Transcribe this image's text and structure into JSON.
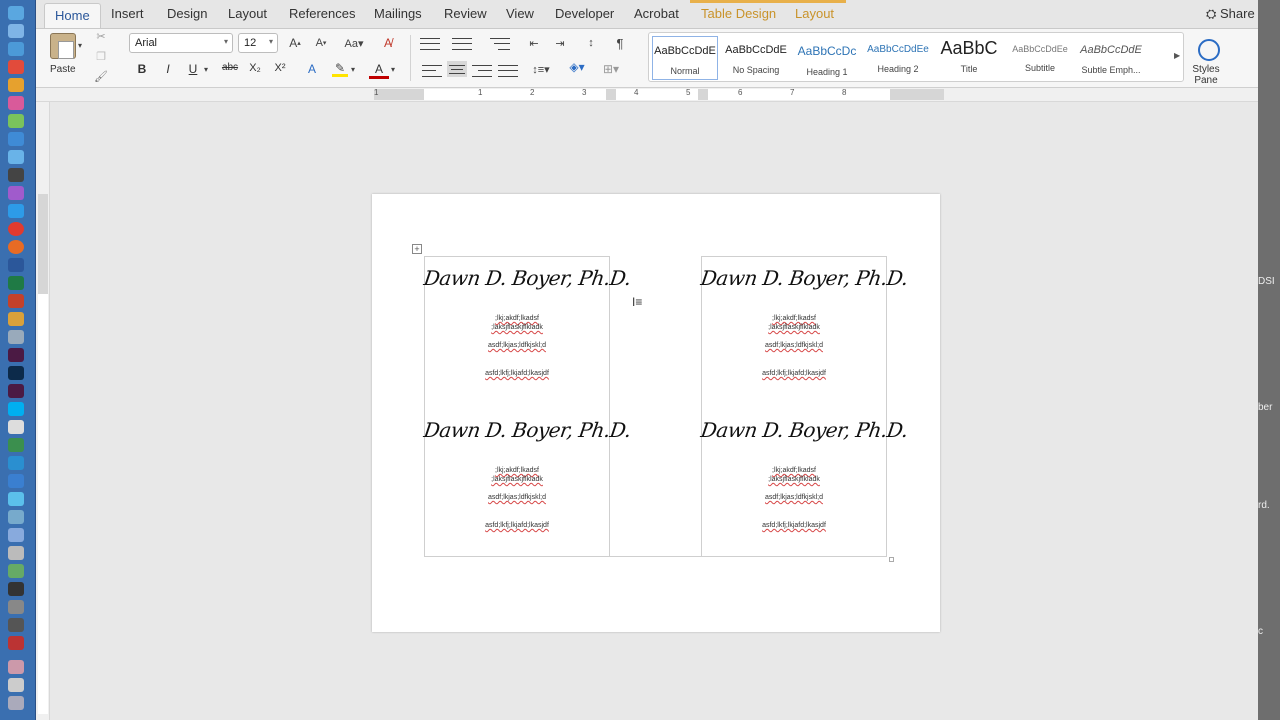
{
  "tabs": [
    {
      "label": "Home"
    },
    {
      "label": "Insert"
    },
    {
      "label": "Design"
    },
    {
      "label": "Layout"
    },
    {
      "label": "References"
    },
    {
      "label": "Mailings"
    },
    {
      "label": "Review"
    },
    {
      "label": "View"
    },
    {
      "label": "Developer"
    },
    {
      "label": "Acrobat"
    }
  ],
  "context_tabs": [
    {
      "label": "Table Design"
    },
    {
      "label": "Layout"
    }
  ],
  "share_label": "Share",
  "clipboard": {
    "paste_label": "Paste"
  },
  "font": {
    "name": "Arial",
    "size": "12"
  },
  "format_buttons": {
    "bold": "B",
    "italic": "I",
    "underline": "U",
    "strike": "abc",
    "sub": "X₂",
    "sup": "X²",
    "font_color": "A",
    "text_effects": "A"
  },
  "paragraph": {
    "show_marks": "¶"
  },
  "styles": [
    {
      "sample": "AaBbCcDdE",
      "name": "Normal"
    },
    {
      "sample": "AaBbCcDdE",
      "name": "No Spacing"
    },
    {
      "sample": "AaBbCcDc",
      "name": "Heading 1"
    },
    {
      "sample": "AaBbCcDdEe",
      "name": "Heading 2"
    },
    {
      "sample": "AaBbC",
      "name": "Title"
    },
    {
      "sample": "AaBbCcDdEe",
      "name": "Subtitle"
    },
    {
      "sample": "AaBbCcDdE",
      "name": "Subtle Emph..."
    }
  ],
  "styles_pane": {
    "line1": "Styles",
    "line2": "Pane"
  },
  "ruler": {
    "numbers": [
      "1",
      "1",
      "2",
      "3",
      "4",
      "5",
      "6",
      "7",
      "8"
    ]
  },
  "labels": [
    {
      "signature": "Dawn D. Boyer, Ph.D.",
      "line1": ";lkj;akdf;lkadsf",
      "line2": ";laksjflaskjflkladk",
      "line3": "asdf;lkjas;ldfkjskl;d",
      "line4": "asfd;lkfj;lkjafd;lkasjdf"
    },
    {
      "signature": "Dawn D. Boyer, Ph.D.",
      "line1": ";lkj;akdf;lkadsf",
      "line2": ";laksjflaskjflkladk",
      "line3": "asdf;lkjas;ldfkjskl;d",
      "line4": "asfd;lkfj;lkjafd;lkasjdf"
    },
    {
      "signature": "Dawn D. Boyer, Ph.D.",
      "line1": ";lkj;akdf;lkadsf",
      "line2": ";laksjflaskjflkladk",
      "line3": "asdf;lkjas;ldfkjskl;d",
      "line4": "asfd;lkfj;lkjafd;lkasjdf"
    },
    {
      "signature": "Dawn D. Boyer, Ph.D.",
      "line1": ";lkj;akdf;lkadsf",
      "line2": ";laksjflaskjflkladk",
      "line3": "asdf;lkjas;ldfkjskl;d",
      "line4": "asfd;lkfj;lkjafd;lkasjdf"
    }
  ],
  "right_edge_fragments": [
    "DSI",
    "ber",
    "rd.",
    "c"
  ],
  "colors": {
    "accent": "#2b579a",
    "context_tab": "#c9932a",
    "dock": "#3a6fb0"
  },
  "icons": [
    "cut-icon",
    "copy-icon",
    "format-painter-icon",
    "grow-font-icon",
    "shrink-font-icon",
    "change-case-icon",
    "clear-formatting-icon",
    "bullets-icon",
    "numbering-icon",
    "multilevel-list-icon",
    "decrease-indent-icon",
    "increase-indent-icon",
    "sort-icon",
    "show-marks-icon",
    "align-left-icon",
    "align-center-icon",
    "align-right-icon",
    "justify-icon",
    "line-spacing-icon",
    "shading-icon",
    "borders-icon",
    "highlight-icon",
    "styles-pane-icon",
    "table-move-handle-icon",
    "text-cursor-icon"
  ]
}
